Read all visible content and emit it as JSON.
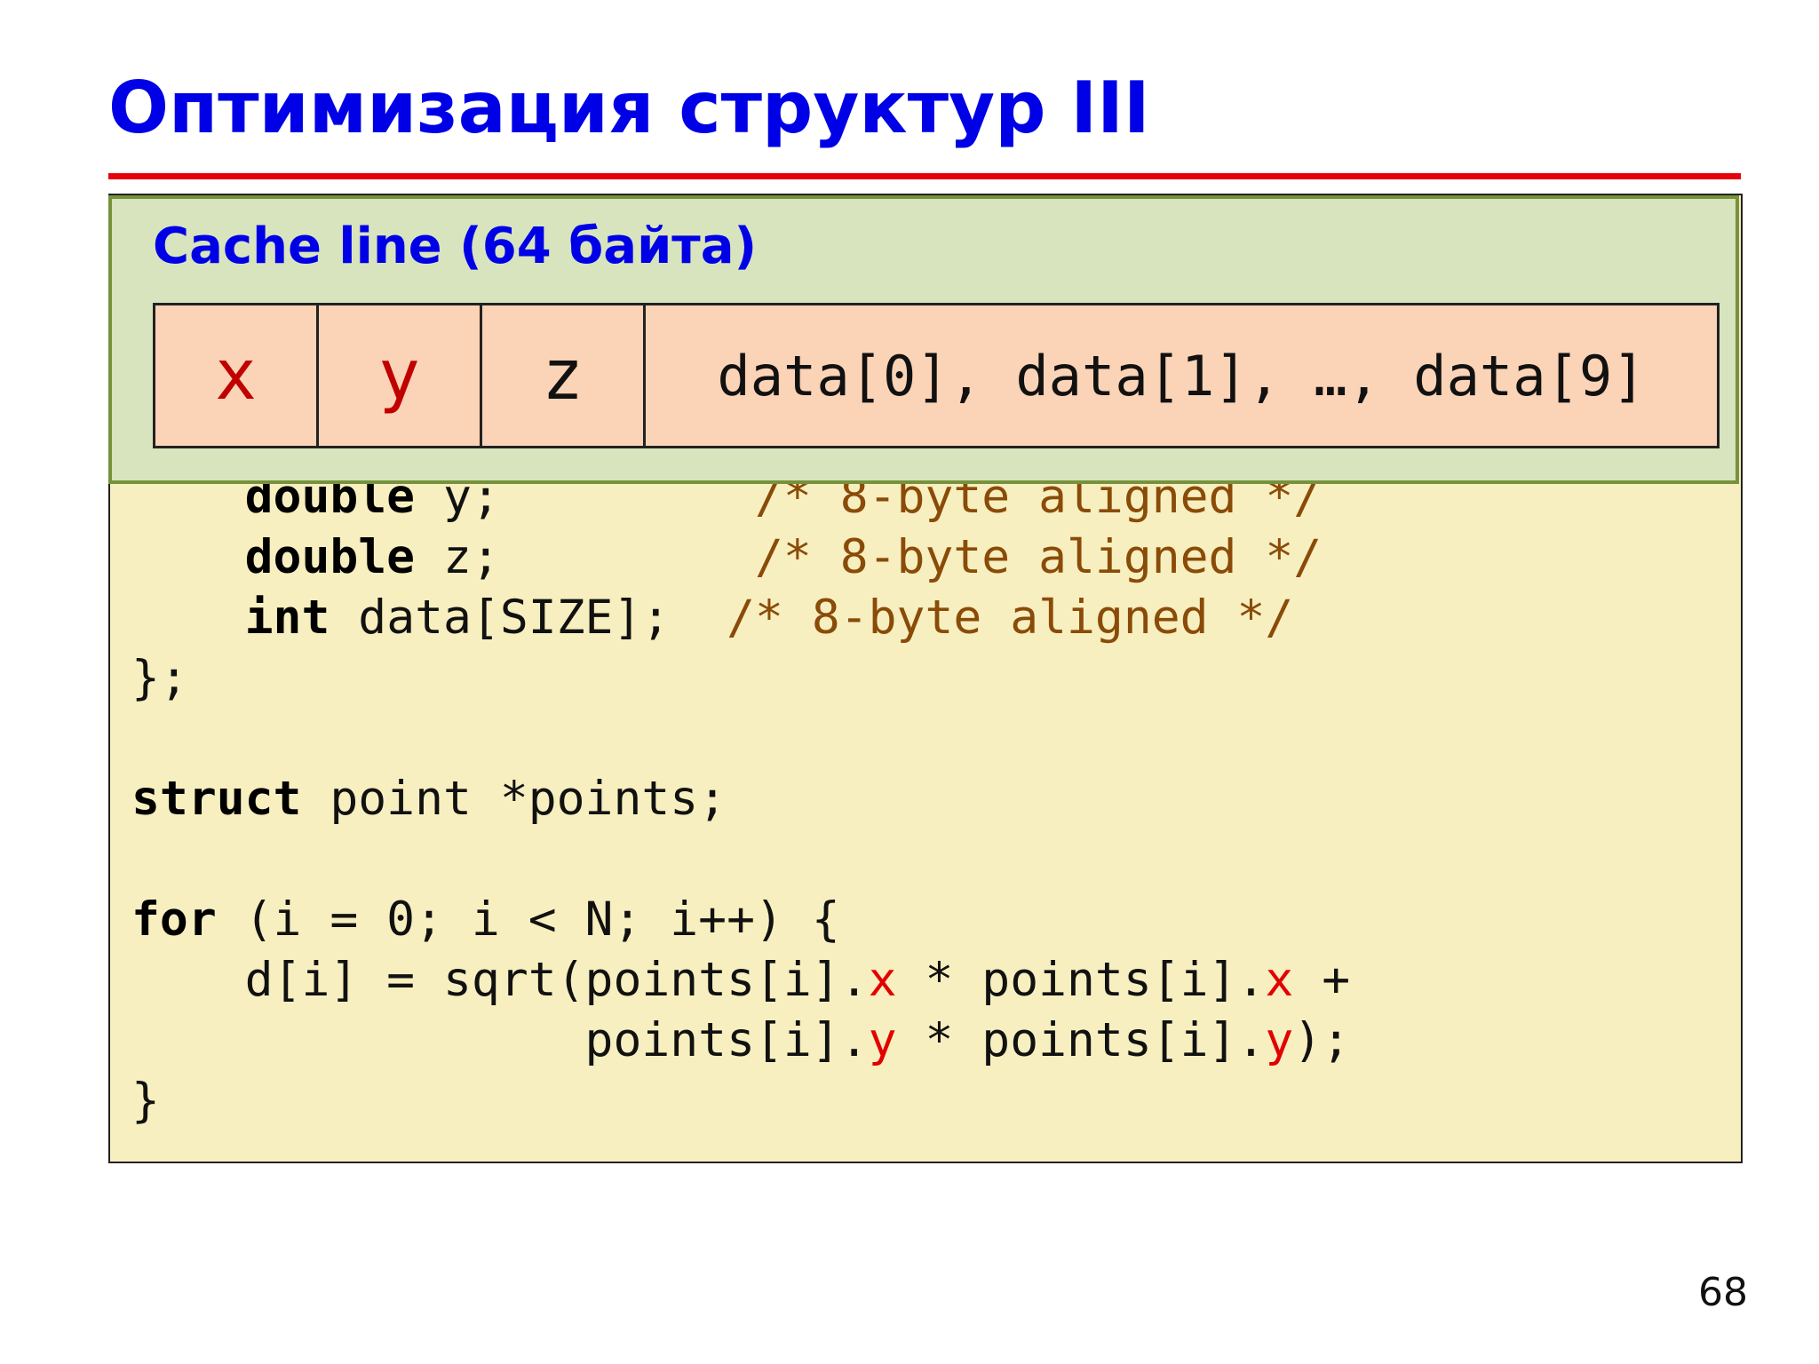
{
  "slide": {
    "title": "Оптимизация структур III",
    "page_number": "68"
  },
  "cache_line": {
    "label": "Cache line (64 байта)",
    "cells": [
      "x",
      "y",
      "z",
      "data[0], data[1], …, data[9]"
    ]
  },
  "code": {
    "line1": {
      "kw": "double",
      "rest": " y;         ",
      "comment": "/* 8-byte aligned */"
    },
    "line2": {
      "kw": "double",
      "rest": " z;         ",
      "comment": "/* 8-byte aligned */"
    },
    "line3": {
      "kw": "int",
      "rest": " data[SIZE];  ",
      "comment": "/* 8-byte aligned */"
    },
    "line4": "};",
    "line5": {
      "kw": "struct",
      "rest": " point *points;"
    },
    "line6": {
      "kw": "for",
      "rest": " (i = 0; i < N; i++) {"
    },
    "line7": {
      "a": "    d[i] = sqrt(points[i].",
      "h1": "x",
      "b": " * points[i].",
      "h2": "x",
      "c": " +"
    },
    "line8": {
      "a": "                points[i].",
      "h1": "y",
      "b": " * points[i].",
      "h2": "y",
      "c": ");"
    },
    "line9": "}"
  },
  "colors": {
    "title": "#0000e6",
    "rule": "#e8000b",
    "code_bg": "#f7efbf",
    "panel_bg": "#d8e4bd",
    "cell_bg": "#fbd3b6",
    "highlight": "#e20000",
    "comment": "#8a4b08"
  }
}
